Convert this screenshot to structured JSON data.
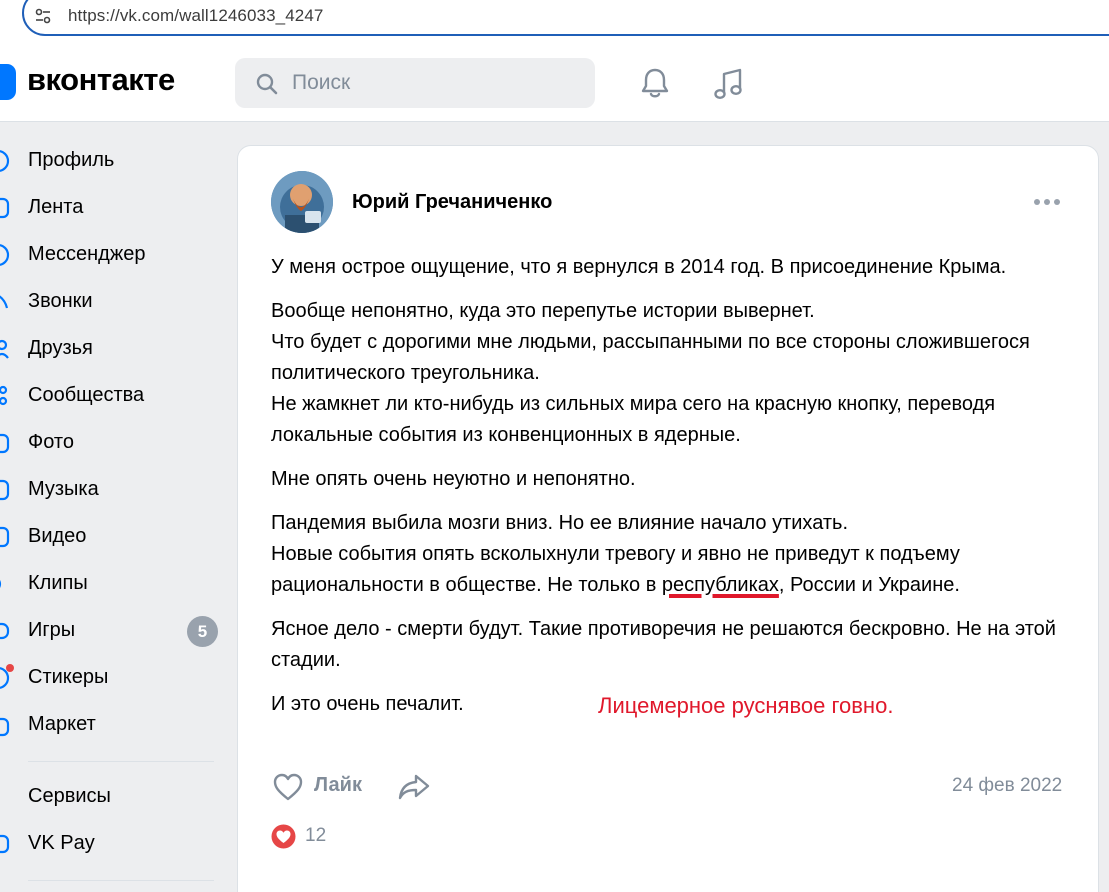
{
  "browser": {
    "url": "https://vk.com/wall1246033_4247"
  },
  "header": {
    "logo_text": "вконтакте",
    "search_placeholder": "Поиск",
    "accent_color": "#0077ff"
  },
  "sidebar": {
    "items": [
      {
        "label": "Профиль",
        "icon": "user-icon"
      },
      {
        "label": "Лента",
        "icon": "feed-icon"
      },
      {
        "label": "Мессенджер",
        "icon": "messenger-icon"
      },
      {
        "label": "Звонки",
        "icon": "phone-icon"
      },
      {
        "label": "Друзья",
        "icon": "friends-icon"
      },
      {
        "label": "Сообщества",
        "icon": "communities-icon"
      },
      {
        "label": "Фото",
        "icon": "photo-icon"
      },
      {
        "label": "Музыка",
        "icon": "music-icon"
      },
      {
        "label": "Видео",
        "icon": "video-icon"
      },
      {
        "label": "Клипы",
        "icon": "clips-icon"
      },
      {
        "label": "Игры",
        "icon": "games-icon",
        "badge": "5"
      },
      {
        "label": "Стикеры",
        "icon": "stickers-icon"
      },
      {
        "label": "Маркет",
        "icon": "market-icon"
      }
    ],
    "secondary_items": [
      {
        "label": "Сервисы",
        "icon": "services-icon"
      },
      {
        "label": "VK Pay",
        "icon": "vkpay-icon"
      }
    ]
  },
  "post": {
    "author": "Юрий Гречаниченко",
    "paragraphs": {
      "p1": "У меня острое ощущение, что я вернулся в 2014 год. В присоединение Крыма.",
      "p2_l1": "Вообще непонятно, куда это перепутье истории вывернет.",
      "p2_l2": "Что будет с дорогими мне людьми, рассыпанными по все стороны сложившегося политического треугольника.",
      "p2_l3": "Не жамкнет ли кто-нибудь из сильных мира сего на красную кнопку, переводя локальные события из конвенционных в ядерные.",
      "p3": "Мне опять очень неуютно и непонятно.",
      "p4_l1": "Пандемия выбила мозги вниз. Но ее влияние начало утихать.",
      "p4_l2_a": "Новые события опять всколыхнули тревогу и явно не приведут к подъему рациональности в обществе. Не только в ",
      "p4_l2_underlined": "республиках",
      "p4_l2_b": ", России и Украине.",
      "p5": "Ясное дело - смерти будут. Такие противоречия не решаются бескровно. Не на этой стадии.",
      "p6": "И это очень печалит."
    },
    "annotation": "Лицемерное руснявое говно.",
    "annotation_color": "#e0182b",
    "like_label": "Лайк",
    "date": "24 фев 2022",
    "reaction_count": "12"
  }
}
